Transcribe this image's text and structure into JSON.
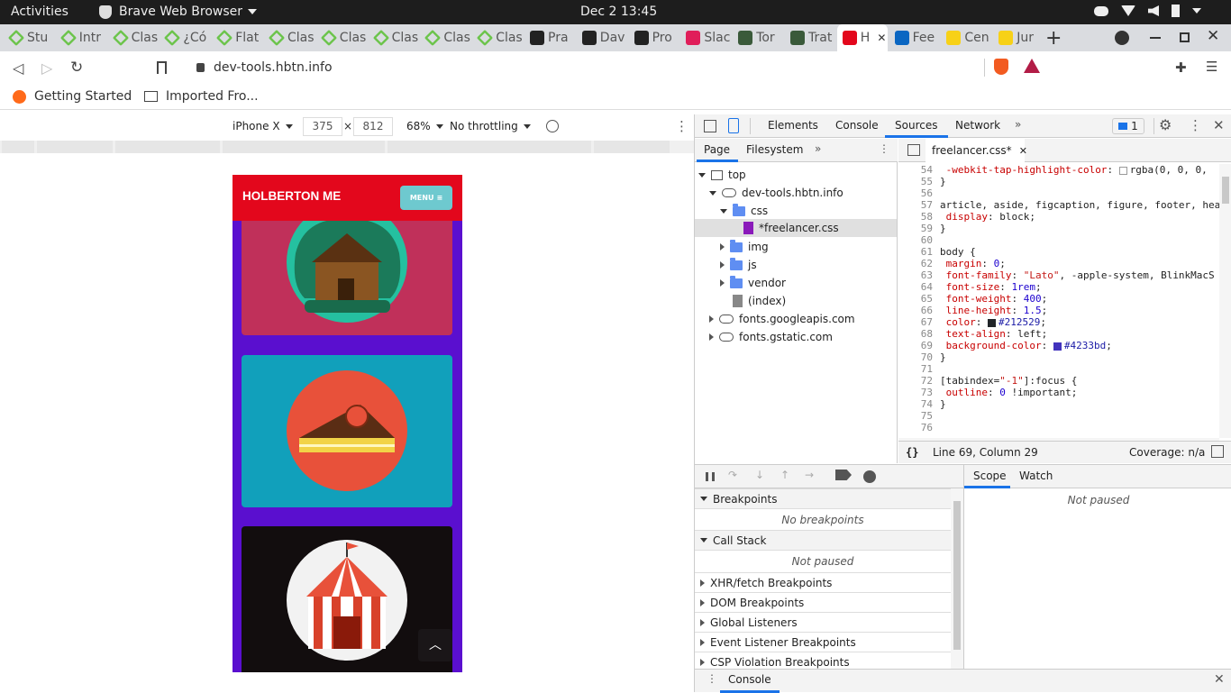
{
  "system_bar": {
    "activities": "Activities",
    "app_name": "Brave Web Browser",
    "clock": "Dec 2  13:45"
  },
  "tabs": [
    {
      "label": "Stu"
    },
    {
      "label": "Intr"
    },
    {
      "label": "Clas"
    },
    {
      "label": "¿Có"
    },
    {
      "label": "Flat"
    },
    {
      "label": "Clas"
    },
    {
      "label": "Clas"
    },
    {
      "label": "Clas"
    },
    {
      "label": "Clas"
    },
    {
      "label": "Clas"
    },
    {
      "label": "Pra"
    },
    {
      "label": "Dav"
    },
    {
      "label": "Pro"
    },
    {
      "label": "Slac"
    },
    {
      "label": "Tor"
    },
    {
      "label": "Trat"
    },
    {
      "label": "H"
    },
    {
      "label": "Fee"
    },
    {
      "label": "Cen"
    },
    {
      "label": "Jur"
    }
  ],
  "address": {
    "url": "dev-tools.hbtn.info"
  },
  "bookmarks": {
    "getting_started": "Getting Started",
    "imported": "Imported Fro..."
  },
  "device_toolbar": {
    "device": "iPhone X",
    "width": "375",
    "times": "×",
    "height": "812",
    "zoom": "68%",
    "throttling": "No throttling"
  },
  "mobile_page": {
    "brand": "HOLBERTON ME",
    "menu_button": "MENU",
    "cards": [
      {
        "name": "cabin",
        "bg": "#c0305a"
      },
      {
        "name": "cake",
        "bg": "#11a0bb"
      },
      {
        "name": "circus",
        "bg": "#120d0e"
      }
    ],
    "page_bg": "#5a0fcf",
    "nav_bg": "#e3071c",
    "menu_bg": "#6ec9cf"
  },
  "devtools": {
    "tabs": [
      "Elements",
      "Console",
      "Sources",
      "Network"
    ],
    "active_tab": "Sources",
    "issues_badge": "1",
    "nav_tabs": [
      "Page",
      "Filesystem"
    ],
    "tree": {
      "top": "top",
      "host": "dev-tools.hbtn.info",
      "css": "css",
      "file": "*freelancer.css",
      "img": "img",
      "js": "js",
      "vendor": "vendor",
      "index": "(index)",
      "g_apis": "fonts.googleapis.com",
      "g_static": "fonts.gstatic.com"
    },
    "editor_tab": "freelancer.css*",
    "code": [
      {
        "n": "54",
        "html": "  <span class='prop'>-webkit-tap-highlight-color</span>: <span class='sw' style='background:#fff;border:1px solid #999'></span>rgba(0, 0, 0,"
      },
      {
        "n": "55",
        "html": "}"
      },
      {
        "n": "56",
        "html": ""
      },
      {
        "n": "57",
        "html": "article, aside, figcaption, figure, footer, hea"
      },
      {
        "n": "58",
        "html": "  <span class='prop'>display</span>: block;"
      },
      {
        "n": "59",
        "html": "}"
      },
      {
        "n": "60",
        "html": ""
      },
      {
        "n": "61",
        "html": "body {"
      },
      {
        "n": "62",
        "html": "  <span class='prop'>margin</span>: <span class='num'>0</span>;"
      },
      {
        "n": "63",
        "html": "  <span class='prop'>font-family</span>: <span class='str'>\"Lato\"</span>, -apple-system, BlinkMacS"
      },
      {
        "n": "64",
        "html": "  <span class='prop'>font-size</span>: <span class='num'>1rem</span>;"
      },
      {
        "n": "65",
        "html": "  <span class='prop'>font-weight</span>: <span class='num'>400</span>;"
      },
      {
        "n": "66",
        "html": "  <span class='prop'>line-height</span>: <span class='num'>1.5</span>;"
      },
      {
        "n": "67",
        "html": "  <span class='prop'>color</span>: <span class='sw' style='background:#212529'></span><span class='kw'>#212529</span>;"
      },
      {
        "n": "68",
        "html": "  <span class='prop'>text-align</span>: left;"
      },
      {
        "n": "69",
        "html": "  <span class='prop'>background-color</span>: <span class='sw' style='background:#4233bd'></span><span class='kw'>#4233bd</span>;"
      },
      {
        "n": "70",
        "html": "}"
      },
      {
        "n": "71",
        "html": ""
      },
      {
        "n": "72",
        "html": "[tabindex=<span class='str'>\"-1\"</span>]:focus {"
      },
      {
        "n": "73",
        "html": "  <span class='prop'>outline</span>: <span class='num'>0</span> !important;"
      },
      {
        "n": "74",
        "html": "}"
      },
      {
        "n": "75",
        "html": ""
      },
      {
        "n": "76",
        "html": ""
      }
    ],
    "status": {
      "braces": "{}",
      "position": "Line 69, Column 29",
      "coverage": "Coverage: n/a"
    },
    "debugger": {
      "breakpoints": "Breakpoints",
      "no_breakpoints": "No breakpoints",
      "call_stack": "Call Stack",
      "not_paused": "Not paused",
      "xhr": "XHR/fetch Breakpoints",
      "dom": "DOM Breakpoints",
      "global": "Global Listeners",
      "event": "Event Listener Breakpoints",
      "csp": "CSP Violation Breakpoints",
      "scope": "Scope",
      "watch": "Watch",
      "scope_not_paused": "Not paused"
    },
    "drawer": {
      "console": "Console"
    }
  }
}
